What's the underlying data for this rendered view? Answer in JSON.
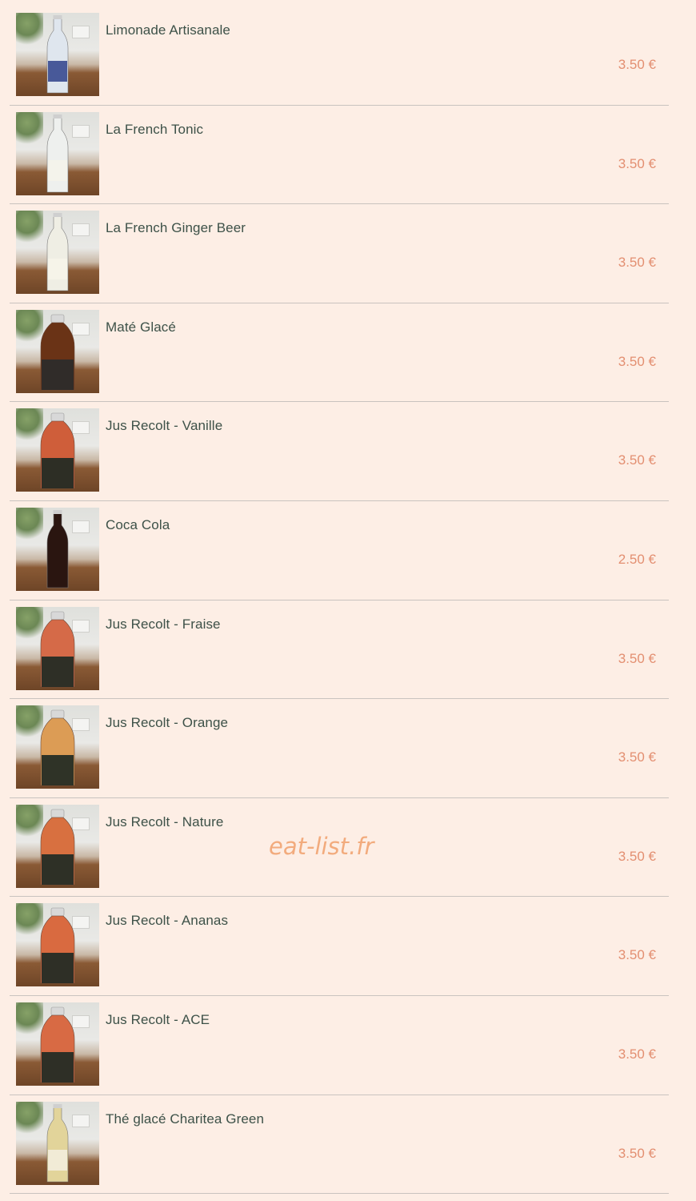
{
  "watermark": "eat-list.fr",
  "accent_colors": {
    "price": "#e38f71",
    "name": "#3d5148",
    "background": "#fdeee5"
  },
  "items": [
    {
      "name": "Limonade Artisanale",
      "price": "3.50 €",
      "icon": "bottle-limonade-icon",
      "bottle": {
        "shape": "tall",
        "liquid": "#dfe6ee",
        "label": "#2e3f8a"
      }
    },
    {
      "name": "La French Tonic",
      "price": "3.50 €",
      "icon": "bottle-tonic-icon",
      "bottle": {
        "shape": "tall",
        "liquid": "#eef0ee",
        "label": "#f5f3ea"
      }
    },
    {
      "name": "La French Ginger Beer",
      "price": "3.50 €",
      "icon": "bottle-ginger-beer-icon",
      "bottle": {
        "shape": "tall",
        "liquid": "#efeee4",
        "label": "#f7f4ea"
      }
    },
    {
      "name": "Maté Glacé",
      "price": "3.50 €",
      "icon": "bottle-mate-icon",
      "bottle": {
        "shape": "round",
        "liquid": "#6a3316",
        "label": "#2b2b2b"
      }
    },
    {
      "name": "Jus Recolt - Vanille",
      "price": "3.50 €",
      "icon": "bottle-juice-vanille-icon",
      "bottle": {
        "shape": "round",
        "liquid": "#cf5e3a",
        "label": "#1f2a24"
      }
    },
    {
      "name": "Coca Cola",
      "price": "2.50 €",
      "icon": "bottle-coca-cola-icon",
      "bottle": {
        "shape": "tall",
        "liquid": "#2a1510",
        "label": "#2a1510"
      }
    },
    {
      "name": "Jus Recolt - Fraise",
      "price": "3.50 €",
      "icon": "bottle-juice-fraise-icon",
      "bottle": {
        "shape": "round",
        "liquid": "#d56a48",
        "label": "#1f2a24"
      }
    },
    {
      "name": "Jus Recolt - Orange",
      "price": "3.50 €",
      "icon": "bottle-juice-orange-icon",
      "bottle": {
        "shape": "round",
        "liquid": "#dc9c55",
        "label": "#1f2a24"
      }
    },
    {
      "name": "Jus Recolt - Nature",
      "price": "3.50 €",
      "icon": "bottle-juice-nature-icon",
      "bottle": {
        "shape": "round",
        "liquid": "#d87040",
        "label": "#1f2a24"
      }
    },
    {
      "name": "Jus Recolt - Ananas",
      "price": "3.50 €",
      "icon": "bottle-juice-ananas-icon",
      "bottle": {
        "shape": "round",
        "liquid": "#d96a40",
        "label": "#1f2a24"
      }
    },
    {
      "name": "Jus Recolt - ACE",
      "price": "3.50 €",
      "icon": "bottle-juice-ace-icon",
      "bottle": {
        "shape": "round",
        "liquid": "#d86a44",
        "label": "#1f2a24"
      }
    },
    {
      "name": "Thé glacé Charitea Green",
      "price": "3.50 €",
      "icon": "bottle-iced-tea-icon",
      "bottle": {
        "shape": "tall",
        "liquid": "#e2d49a",
        "label": "#f3efe0"
      }
    }
  ]
}
